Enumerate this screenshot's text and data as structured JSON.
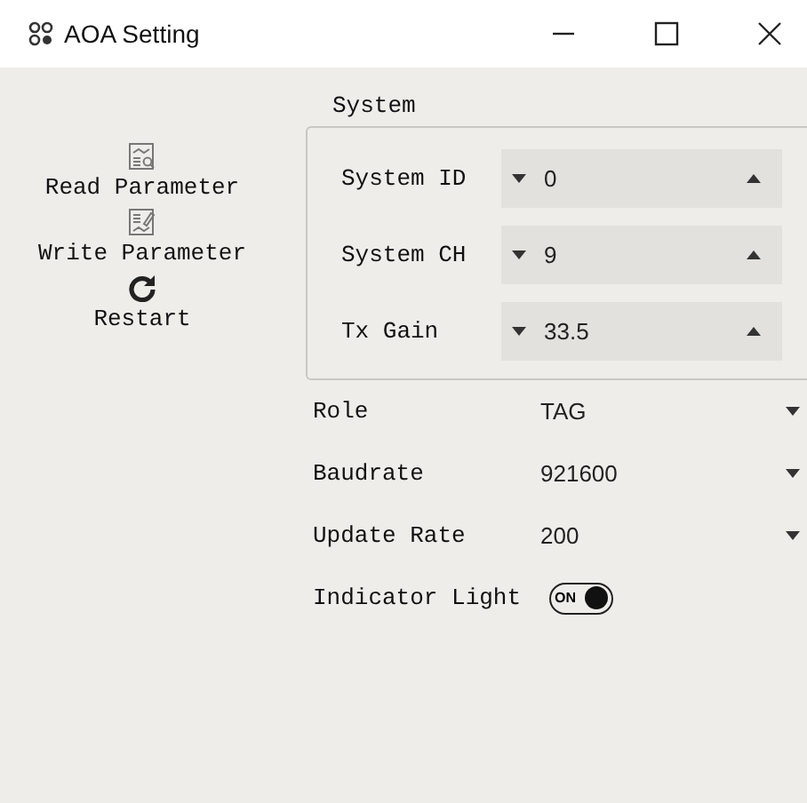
{
  "window": {
    "title": "AOA Setting"
  },
  "sidebar": {
    "items": [
      {
        "kind": "read",
        "label": "Read Parameter"
      },
      {
        "kind": "write",
        "label": "Write Parameter"
      },
      {
        "kind": "restart",
        "label": "Restart"
      }
    ]
  },
  "system": {
    "title": "System",
    "fields": [
      {
        "label": "System ID",
        "value": "0"
      },
      {
        "label": "System CH",
        "value": "9"
      },
      {
        "label": "Tx Gain",
        "value": "33.5"
      }
    ]
  },
  "settings": [
    {
      "kind": "dropdown",
      "label": "Role",
      "value": "TAG"
    },
    {
      "kind": "dropdown",
      "label": "Baudrate",
      "value": "921600"
    },
    {
      "kind": "dropdown",
      "label": "Update Rate",
      "value": "200"
    },
    {
      "kind": "toggle",
      "label": "Indicator Light",
      "on_text": "ON",
      "on": true
    }
  ]
}
